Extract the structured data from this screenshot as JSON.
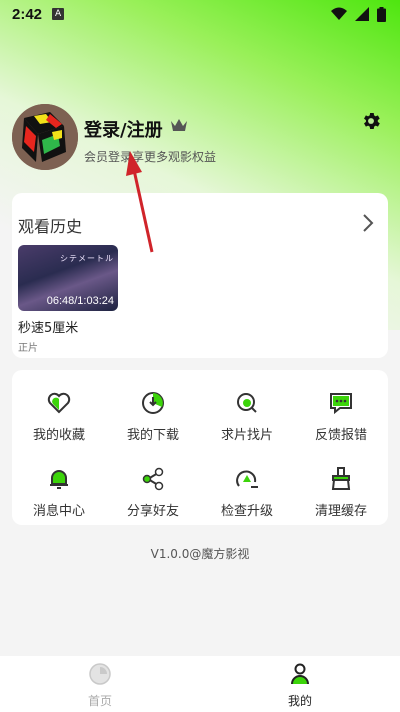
{
  "status": {
    "time": "2:42",
    "a_badge": "A"
  },
  "profile": {
    "login_label": "登录/注册",
    "subtitle": "会员登录享更多观影权益"
  },
  "history": {
    "title": "观看历史",
    "items": [
      {
        "thumb_text": "シテメートル",
        "duration": "06:48/1:03:24",
        "title": "秒速5厘米",
        "subtitle": "正片"
      }
    ]
  },
  "menu": {
    "items": [
      {
        "label": "我的收藏",
        "icon": "heart-icon"
      },
      {
        "label": "我的下载",
        "icon": "download-icon"
      },
      {
        "label": "求片找片",
        "icon": "search-film-icon"
      },
      {
        "label": "反馈报错",
        "icon": "feedback-icon"
      },
      {
        "label": "消息中心",
        "icon": "bell-icon"
      },
      {
        "label": "分享好友",
        "icon": "share-icon"
      },
      {
        "label": "检查升级",
        "icon": "upgrade-icon"
      },
      {
        "label": "清理缓存",
        "icon": "clean-icon"
      }
    ]
  },
  "footer": {
    "version": "V1.0.0@魔方影视"
  },
  "nav": {
    "home": "首页",
    "mine": "我的"
  },
  "colors": {
    "accent": "#3cd40a",
    "card": "#ffffff",
    "arrow": "#d0242a"
  }
}
